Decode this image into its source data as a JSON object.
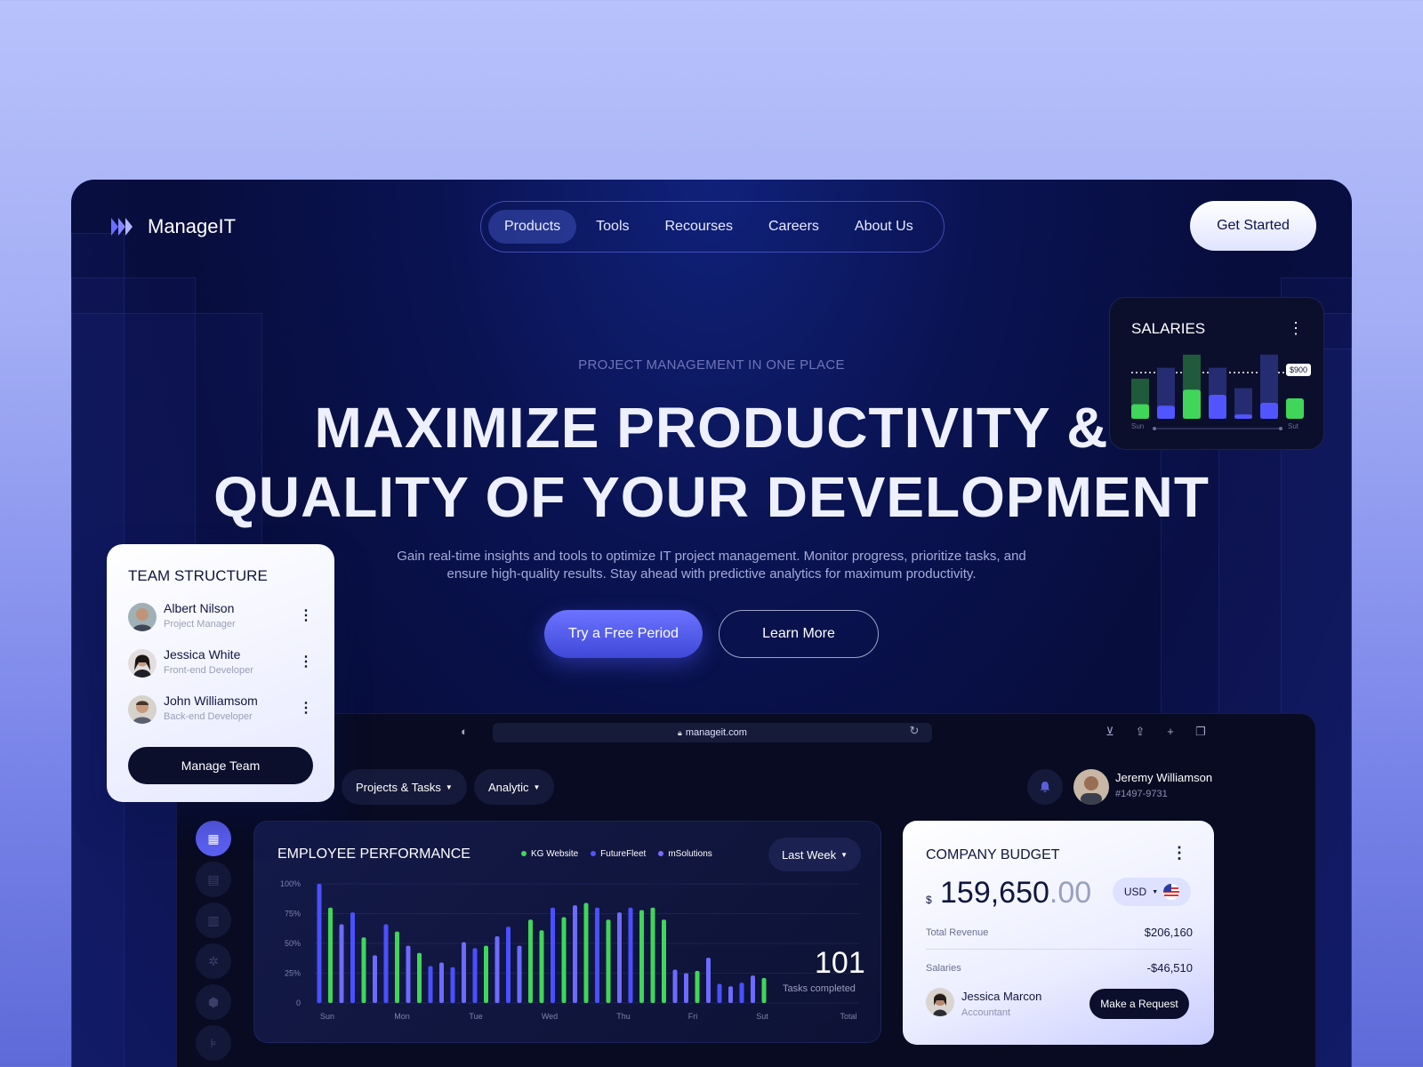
{
  "brand": {
    "name": "ManageIT"
  },
  "nav": {
    "items": [
      {
        "label": "Products",
        "active": true
      },
      {
        "label": "Tools",
        "active": false
      },
      {
        "label": "Recourses",
        "active": false
      },
      {
        "label": "Careers",
        "active": false
      },
      {
        "label": "About Us",
        "active": false
      }
    ],
    "cta": "Get Started"
  },
  "hero": {
    "eyebrow": "PROJECT MANAGEMENT IN ONE PLACE",
    "headline_line1": "MAXIMIZE PRODUCTIVITY &",
    "headline_line2": "QUALITY OF YOUR DEVELOPMENT",
    "subtitle_line1": "Gain real-time insights and tools to optimize IT project management. Monitor progress, prioritize tasks, and",
    "subtitle_line2": "ensure high-quality results. Stay ahead with predictive analytics for maximum productivity.",
    "primary_button": "Try a Free Period",
    "secondary_button": "Learn More"
  },
  "salaries": {
    "title": "SALARIES",
    "threshold_label": "$900",
    "x_start": "Sun",
    "x_end": "Sut",
    "bars": [
      {
        "back": 0.55,
        "front": 0.2,
        "color": "green"
      },
      {
        "back": 0.7,
        "front": 0.18,
        "color": "blue"
      },
      {
        "back": 0.88,
        "front": 0.4,
        "color": "green"
      },
      {
        "back": 0.7,
        "front": 0.33,
        "color": "blue"
      },
      {
        "back": 0.42,
        "front": 0.06,
        "color": "blue"
      },
      {
        "back": 0.88,
        "front": 0.22,
        "color": "blue"
      },
      {
        "back": 0.0,
        "front": 0.28,
        "color": "green"
      }
    ]
  },
  "team": {
    "title": "TEAM STRUCTURE",
    "members": [
      {
        "name": "Albert Nilson",
        "role": "Project Manager"
      },
      {
        "name": "Jessica White",
        "role": "Front-end Developer"
      },
      {
        "name": "John Williamsom",
        "role": "Back-end Developer"
      }
    ],
    "button": "Manage Team"
  },
  "browser": {
    "url": "manageit.com"
  },
  "dashboard": {
    "tabs": [
      "Projects & Tasks",
      "Analytic"
    ],
    "user": {
      "name": "Jeremy Williamson",
      "id": "#1497-9731"
    }
  },
  "performance": {
    "title": "EMPLOYEE PERFORMANCE",
    "legend": [
      {
        "name": "KG Website",
        "color": "#3fd65a"
      },
      {
        "name": "FutureFleet",
        "color": "#5055ff"
      },
      {
        "name": "mSolutions",
        "color": "#7a6bff"
      }
    ],
    "period": "Last Week",
    "tasks_value": "101",
    "tasks_label": "Tasks completed"
  },
  "chart_data": {
    "type": "bar",
    "y_ticks": [
      "100%",
      "75%",
      "50%",
      "25%",
      "0"
    ],
    "ylim": [
      0,
      100
    ],
    "x_labels": [
      "Sun",
      "Mon",
      "Tue",
      "Wed",
      "Thu",
      "Fri",
      "Sut",
      "Total"
    ],
    "bars": [
      {
        "v": 100,
        "c": "#4a50ff"
      },
      {
        "v": 80,
        "c": "#3fd65a"
      },
      {
        "v": 66,
        "c": "#6d6bff"
      },
      {
        "v": 76,
        "c": "#4a50ff"
      },
      {
        "v": 55,
        "c": "#3fd65a"
      },
      {
        "v": 40,
        "c": "#6d6bff"
      },
      {
        "v": 66,
        "c": "#4a50ff"
      },
      {
        "v": 60,
        "c": "#3fd65a"
      },
      {
        "v": 48,
        "c": "#6d6bff"
      },
      {
        "v": 42,
        "c": "#3fd65a"
      },
      {
        "v": 31,
        "c": "#4a50ff"
      },
      {
        "v": 34,
        "c": "#6d6bff"
      },
      {
        "v": 30,
        "c": "#4a50ff"
      },
      {
        "v": 51,
        "c": "#6d6bff"
      },
      {
        "v": 46,
        "c": "#4a50ff"
      },
      {
        "v": 48,
        "c": "#3fd65a"
      },
      {
        "v": 56,
        "c": "#6d6bff"
      },
      {
        "v": 64,
        "c": "#4a50ff"
      },
      {
        "v": 48,
        "c": "#6d6bff"
      },
      {
        "v": 70,
        "c": "#3fd65a"
      },
      {
        "v": 61,
        "c": "#3fd65a"
      },
      {
        "v": 80,
        "c": "#4a50ff"
      },
      {
        "v": 72,
        "c": "#3fd65a"
      },
      {
        "v": 82,
        "c": "#6d6bff"
      },
      {
        "v": 84,
        "c": "#3fd65a"
      },
      {
        "v": 80,
        "c": "#4a50ff"
      },
      {
        "v": 70,
        "c": "#3fd65a"
      },
      {
        "v": 76,
        "c": "#6d6bff"
      },
      {
        "v": 80,
        "c": "#4a50ff"
      },
      {
        "v": 78,
        "c": "#3fd65a"
      },
      {
        "v": 80,
        "c": "#3fd65a"
      },
      {
        "v": 70,
        "c": "#3fd65a"
      },
      {
        "v": 28,
        "c": "#6d6bff"
      },
      {
        "v": 25,
        "c": "#6d6bff"
      },
      {
        "v": 27,
        "c": "#3fd65a"
      },
      {
        "v": 38,
        "c": "#6d6bff"
      },
      {
        "v": 16,
        "c": "#4a50ff"
      },
      {
        "v": 14,
        "c": "#6d6bff"
      },
      {
        "v": 17,
        "c": "#4a50ff"
      },
      {
        "v": 23,
        "c": "#6d6bff"
      },
      {
        "v": 21,
        "c": "#3fd65a"
      }
    ]
  },
  "budget": {
    "title": "COMPANY BUDGET",
    "currency_symbol": "$",
    "amount_int": "159,650",
    "amount_dec": ".00",
    "currency": "USD",
    "revenue_label": "Total Revenue",
    "revenue_value": "$206,160",
    "salaries_label": "Salaries",
    "salaries_value": "-$46,510",
    "person_name": "Jessica Marcon",
    "person_role": "Accountant",
    "button": "Make a Request"
  }
}
